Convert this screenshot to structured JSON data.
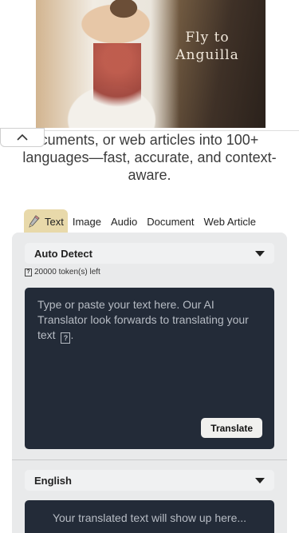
{
  "ad": {
    "caption_line1": "Fly to",
    "caption_line2": "Anguilla"
  },
  "collapse": {
    "icon": "chevron-up-icon"
  },
  "hero": {
    "text": "cuments, or web articles into 100+ languages—fast, accurate, and context-aware."
  },
  "tabs": [
    {
      "label": "Text",
      "icon": "pencil-icon",
      "active": true
    },
    {
      "label": "Image",
      "active": false
    },
    {
      "label": "Audio",
      "active": false
    },
    {
      "label": "Document",
      "active": false
    },
    {
      "label": "Web Article",
      "active": false
    }
  ],
  "source": {
    "language": "Auto Detect",
    "tokens_left": "20000 token(s) left",
    "placeholder": "Type or paste your text here. Our AI Translator look forwards to translating your text",
    "translate_label": "Translate"
  },
  "target": {
    "language": "English",
    "placeholder": "Your translated text will show up here..."
  },
  "colors": {
    "tab_active": "#e8d9aa",
    "panel_bg": "#e9eaeb",
    "editor_bg": "#232b38"
  }
}
